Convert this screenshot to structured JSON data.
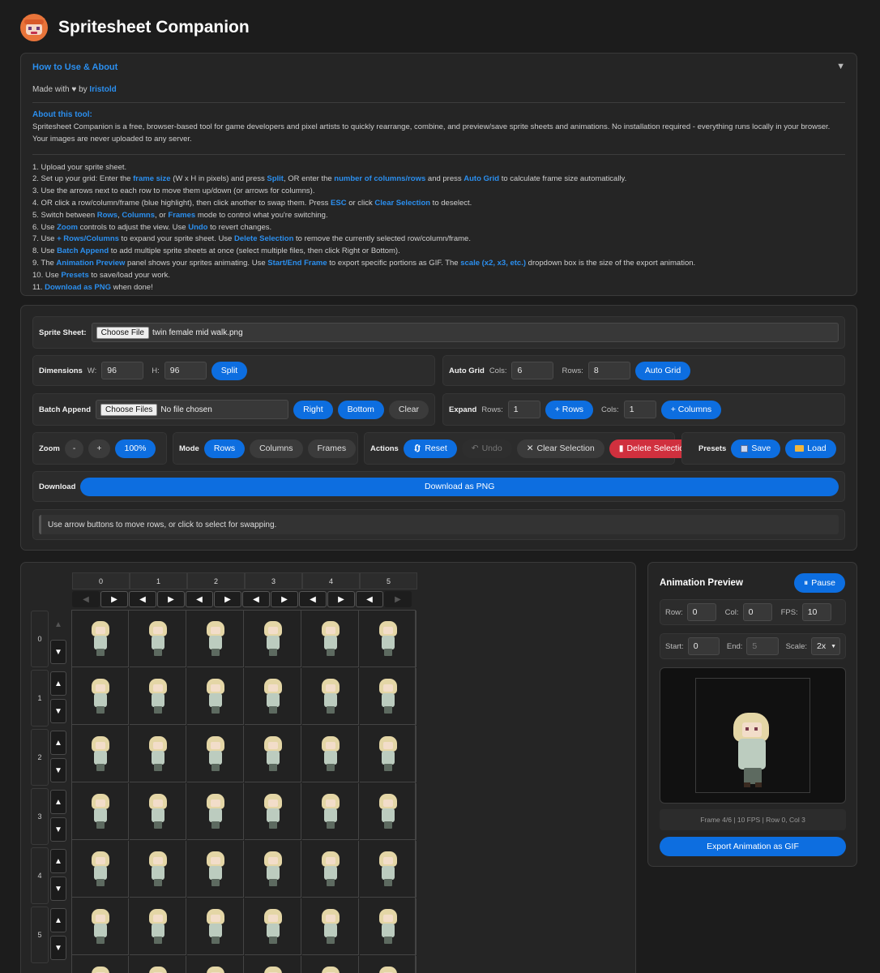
{
  "app": {
    "title": "Spritesheet Companion"
  },
  "about": {
    "title": "How to Use & About",
    "toggle": "▼",
    "made_with_prefix": "Made with ♥ by ",
    "author": "Iristold",
    "about_heading": "About this tool:",
    "about_text": "Spritesheet Companion is a free, browser-based tool for game developers and pixel artists to quickly rearrange, combine, and preview/save sprite sheets and animations. No installation required - everything runs locally in your browser. Your images are never uploaded to any server.",
    "steps": [
      [
        "1. Upload your sprite sheet."
      ],
      [
        "2. Set up your grid: Enter the ",
        "*frame size",
        " (W x H in pixels) and press ",
        "*Split",
        ", OR enter the ",
        "*number of columns/rows",
        " and press ",
        "*Auto Grid",
        " to calculate frame size automatically."
      ],
      [
        "3. Use the arrows next to each row to move them up/down (or arrows for columns)."
      ],
      [
        "4. OR click a row/column/frame (blue highlight), then click another to swap them. Press ",
        "*ESC",
        " or click ",
        "*Clear Selection",
        " to deselect."
      ],
      [
        "5. Switch between ",
        "*Rows",
        ", ",
        "*Columns",
        ", or ",
        "*Frames",
        " mode to control what you're switching."
      ],
      [
        "6. Use ",
        "*Zoom",
        " controls to adjust the view. Use ",
        "*Undo",
        " to revert changes."
      ],
      [
        "7. Use ",
        "*+ Rows/Columns",
        " to expand your sprite sheet. Use ",
        "*Delete Selection",
        " to remove the currently selected row/column/frame."
      ],
      [
        "8. Use ",
        "*Batch Append",
        " to add multiple sprite sheets at once (select multiple files, then click Right or Bottom)."
      ],
      [
        "9. The ",
        "*Animation Preview",
        " panel shows your sprites animating. Use ",
        "*Start/End Frame",
        " to export specific portions as GIF. The ",
        "*scale (x2, x3, etc.)",
        " dropdown box is the size of the export animation."
      ],
      [
        "10. Use ",
        "*Presets",
        " to save/load your work."
      ],
      [
        "11. ",
        "*Download as PNG",
        " when done!"
      ]
    ]
  },
  "controls": {
    "sprite_sheet_label": "Sprite Sheet:",
    "choose_file": "Choose File",
    "sprite_file_name": "twin female mid walk.png",
    "dimensions_label": "Dimensions",
    "w_label": "W:",
    "w_value": "96",
    "h_label": "H:",
    "h_value": "96",
    "split": "Split",
    "autogrid_label": "Auto Grid",
    "cols_label": "Cols:",
    "cols_value": "6",
    "rows_label": "Rows:",
    "rows_value": "8",
    "autogrid_button": "Auto Grid",
    "batch_label": "Batch Append",
    "choose_files": "Choose Files",
    "no_file": "No file chosen",
    "right": "Right",
    "bottom": "Bottom",
    "clear": "Clear",
    "expand_label": "Expand",
    "expand_rows_label": "Rows:",
    "expand_rows_value": "1",
    "add_rows": "+ Rows",
    "expand_cols_label": "Cols:",
    "expand_cols_value": "1",
    "add_cols": "+ Columns",
    "zoom_label": "Zoom",
    "zoom_minus": "-",
    "zoom_plus": "+",
    "zoom_value": "100%",
    "mode_label": "Mode",
    "mode_rows": "Rows",
    "mode_columns": "Columns",
    "mode_frames": "Frames",
    "actions_label": "Actions",
    "reset": "Reset",
    "undo": "Undo",
    "clear_selection": "Clear Selection",
    "delete_selection": "Delete Selection",
    "presets_label": "Presets",
    "save": "Save",
    "load": "Load",
    "download_label": "Download",
    "download_png": "Download as PNG",
    "hint": "Use arrow buttons to move rows, or click to select for swapping."
  },
  "grid": {
    "columns": [
      "0",
      "1",
      "2",
      "3",
      "4",
      "5"
    ],
    "rows": [
      "0",
      "1",
      "2",
      "3",
      "4",
      "5"
    ]
  },
  "preview": {
    "title": "Animation Preview",
    "pause": "Pause",
    "row_label": "Row:",
    "row_value": "0",
    "col_label": "Col:",
    "col_value": "0",
    "fps_label": "FPS:",
    "fps_value": "10",
    "start_label": "Start:",
    "start_value": "0",
    "end_label": "End:",
    "end_value": "5",
    "scale_label": "Scale:",
    "scale_value": "2x",
    "status": "Frame 4/6 | 10 FPS | Row 0, Col 3",
    "export": "Export Animation as GIF"
  },
  "colors": {
    "accent": "#0d6ee0",
    "link": "#2b8fef",
    "danger": "#d0303e",
    "bg": "#1c1c1c",
    "panel": "#252525"
  }
}
